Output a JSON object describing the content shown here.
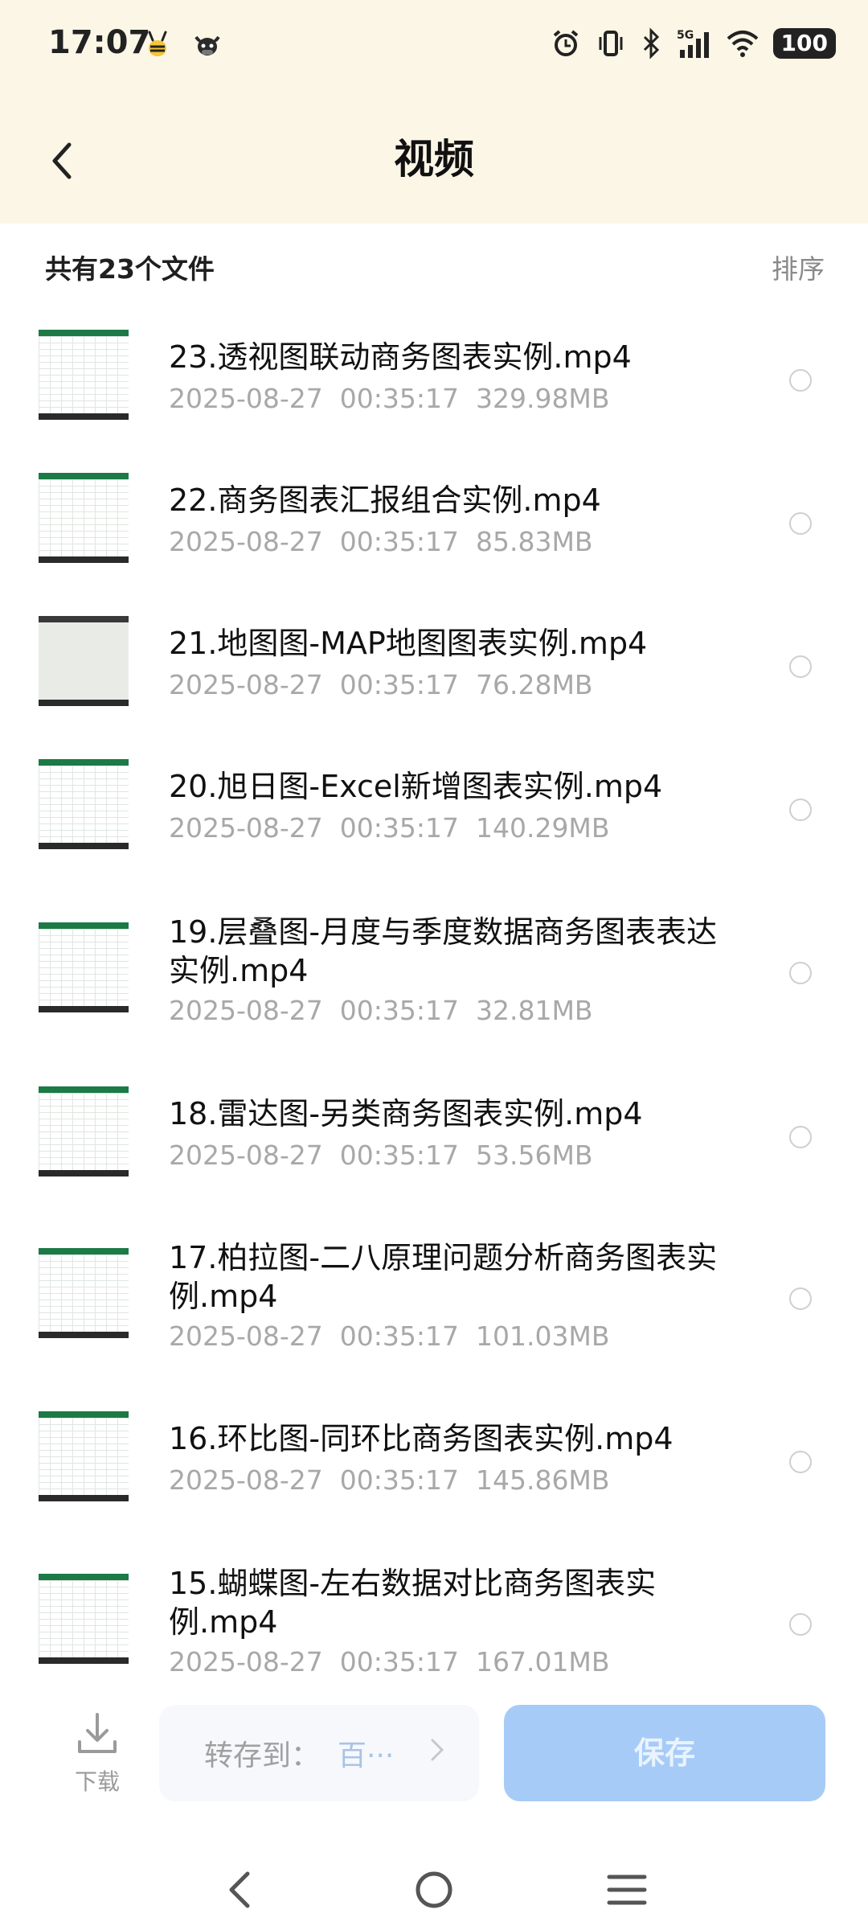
{
  "status_bar": {
    "time": "17:07",
    "battery": "100",
    "network": "5G",
    "icons": [
      "bee-app-icon",
      "cow-app-icon",
      "alarm-icon",
      "vibrate-icon",
      "bluetooth-icon",
      "signal-icon",
      "wifi-icon",
      "battery-icon"
    ]
  },
  "header": {
    "title": "视频",
    "back_icon": "chevron-left-icon"
  },
  "summary": {
    "count_text": "共有23个文件",
    "sort_label": "排序"
  },
  "files": [
    {
      "name": "23.透视图联动商务图表实例.mp4",
      "date": "2025-08-27",
      "time": "00:35:17",
      "size": "329.98MB"
    },
    {
      "name": "22.商务图表汇报组合实例.mp4",
      "date": "2025-08-27",
      "time": "00:35:17",
      "size": "85.83MB"
    },
    {
      "name": "21.地图图-MAP地图图表实例.mp4",
      "date": "2025-08-27",
      "time": "00:35:17",
      "size": "76.28MB"
    },
    {
      "name": "20.旭日图-Excel新增图表实例.mp4",
      "date": "2025-08-27",
      "time": "00:35:17",
      "size": "140.29MB"
    },
    {
      "name": "19.层叠图-月度与季度数据商务图表表达实例.mp4",
      "date": "2025-08-27",
      "time": "00:35:17",
      "size": "32.81MB"
    },
    {
      "name": "18.雷达图-另类商务图表实例.mp4",
      "date": "2025-08-27",
      "time": "00:35:17",
      "size": "53.56MB"
    },
    {
      "name": "17.柏拉图-二八原理问题分析商务图表实例.mp4",
      "date": "2025-08-27",
      "time": "00:35:17",
      "size": "101.03MB"
    },
    {
      "name": "16.环比图-同环比商务图表实例.mp4",
      "date": "2025-08-27",
      "time": "00:35:17",
      "size": "145.86MB"
    },
    {
      "name": "15.蝴蝶图-左右数据对比商务图表实例.mp4",
      "date": "2025-08-27",
      "time": "00:35:17",
      "size": "167.01MB"
    }
  ],
  "bottom_bar": {
    "download_label": "下载",
    "save_to_label": "转存到：",
    "save_to_target": "百···",
    "save_button": "保存"
  },
  "colors": {
    "header_bg": "#fcf6e6",
    "save_button_bg": "#a6cbf7",
    "meta_text": "#a8a8a8"
  }
}
